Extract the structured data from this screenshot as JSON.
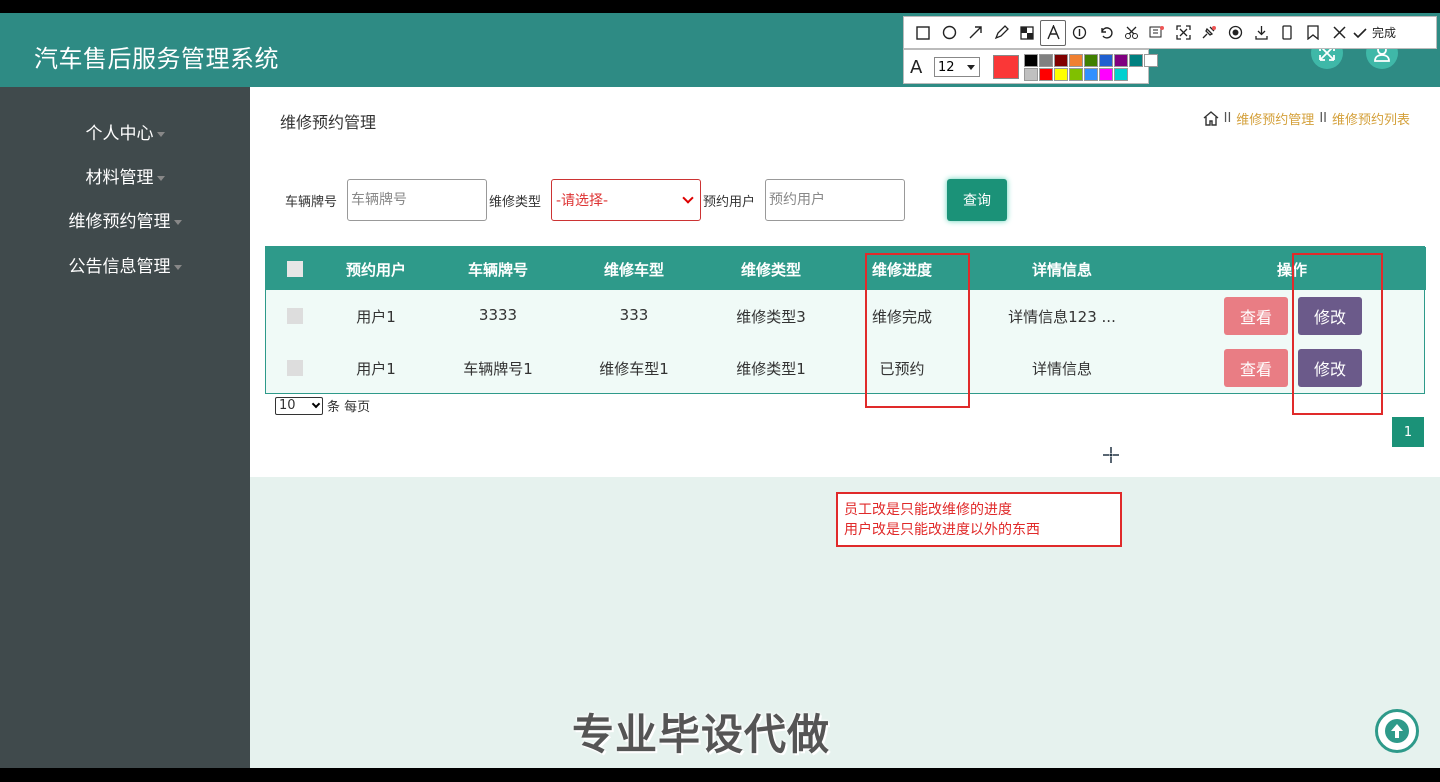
{
  "app": {
    "title": "汽车售后服务管理系统"
  },
  "header": {
    "fullscreen_icon": "expand-icon",
    "user_icon": "user-icon"
  },
  "sidebar": {
    "items": [
      {
        "label": "个人中心"
      },
      {
        "label": "材料管理"
      },
      {
        "label": "维修预约管理"
      },
      {
        "label": "公告信息管理"
      }
    ]
  },
  "page": {
    "title": "维修预约管理"
  },
  "breadcrumb": {
    "sep": "II",
    "items": [
      "维修预约管理",
      "维修预约列表"
    ]
  },
  "search": {
    "plate_label": "车辆牌号",
    "plate_placeholder": "车辆牌号",
    "type_label": "维修类型",
    "type_selected": "-请选择-",
    "user_label": "预约用户",
    "user_placeholder": "预约用户",
    "query_label": "查询"
  },
  "table": {
    "headers": [
      "预约用户",
      "车辆牌号",
      "维修车型",
      "维修类型",
      "维修进度",
      "详情信息",
      "操作"
    ],
    "rows": [
      {
        "user": "用户1",
        "plate": "3333",
        "model": "333",
        "type": "维修类型3",
        "progress": "维修完成",
        "detail": "详情信息123 ...",
        "view": "查看",
        "edit": "修改"
      },
      {
        "user": "用户1",
        "plate": "车辆牌号1",
        "model": "维修车型1",
        "type": "维修类型1",
        "progress": "已预约",
        "detail": "详情信息",
        "view": "查看",
        "edit": "修改"
      }
    ]
  },
  "pagination": {
    "page_size": "10",
    "per_page_label": "条 每页",
    "current_page": "1"
  },
  "annotation": {
    "line1": "员工改是只能改维修的进度",
    "line2": "用户改是只能改进度以外的东西"
  },
  "watermark": {
    "text": "专业毕设代做"
  },
  "toolbar": {
    "done_label": "完成",
    "font_size": "12"
  },
  "colors": {
    "header": "#2e8b84",
    "sidebar": "#404a4c",
    "accent": "#1b9278",
    "view_button": "#e97d84",
    "edit_button": "#6b5a8a",
    "annotation": "#e02a2a",
    "breadcrumb_link": "#d4a03a",
    "palette": [
      "#000000",
      "#808080",
      "#800000",
      "#f08030",
      "#408000",
      "#2060d0",
      "#800080",
      "#008080",
      "#ffffff",
      "#c0c0c0",
      "#ff0000",
      "#ffff00",
      "#80c000",
      "#3090ff",
      "#ff00ff",
      "#00d0d0"
    ]
  }
}
